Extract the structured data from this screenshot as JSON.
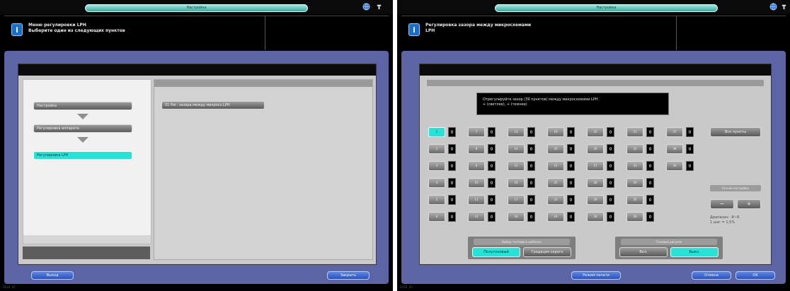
{
  "left_screen": {
    "title": "Настройка",
    "message": [
      "Меню регулировки LPH",
      "Выберите один из следующих пунктов"
    ],
    "nav": [
      {
        "label": "Настройка"
      },
      {
        "label": "Регулировка аппарата"
      },
      {
        "label": "Регулировка LPH"
      }
    ],
    "option_button": "01 Рег. зазора между микросх.LPH",
    "back_button": "Выход",
    "close_button": "Закрыть",
    "footer": "2030 .45"
  },
  "right_screen": {
    "title": "Настройка",
    "message": [
      "Регулировка зазора между микросхемами",
      "LPH"
    ],
    "instruction": [
      "Отрегулируйте зазор (39 пунктов) между микросхемами LPH",
      "+ (светлее), + (темнее)"
    ],
    "all_items_button": "Все пункты",
    "manual_adjust_label": "Ручная настройка",
    "minus_button": "−",
    "plus_button": "+",
    "range_lines": [
      "Диапазон: -8~8",
      "1 шаг = 1,5%"
    ],
    "test_pattern_label": "Выбор тестового шаблона",
    "test_pattern_options": [
      "Полутоновый",
      "Градация серого"
    ],
    "density_label": "Тоновый рисунок",
    "density_options": [
      "Вкл.",
      "Выкл."
    ],
    "print_mode_button": "Режим печати",
    "cancel_button": "Отмена",
    "ok_button": "OK",
    "footer": "2030 .45",
    "grid_columns": [
      [
        "1",
        "2",
        "3",
        "4",
        "5",
        "6"
      ],
      [
        "7",
        "8",
        "9",
        "10",
        "11",
        "12"
      ],
      [
        "13",
        "14",
        "15",
        "16",
        "17",
        "18"
      ],
      [
        "19",
        "20",
        "21",
        "22",
        "23",
        "24"
      ],
      [
        "25",
        "26",
        "27",
        "28",
        "29",
        "30"
      ],
      [
        "31",
        "32",
        "33",
        "34",
        "35",
        "36"
      ],
      [
        "37",
        "38",
        "39"
      ]
    ],
    "grid_values": "0"
  }
}
